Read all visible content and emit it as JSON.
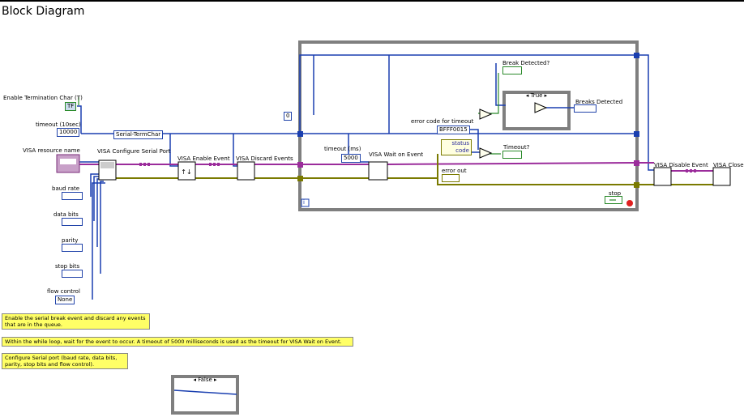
{
  "window": {
    "title": "Block Diagram"
  },
  "inputs": {
    "term_char_enable": {
      "label": "Enable Termination Char (T)",
      "value": "TF"
    },
    "timeout": {
      "label": "timeout (10sec)",
      "value": "10000"
    },
    "resource": {
      "label": "VISA resource name"
    },
    "baud_rate": {
      "label": "baud rate"
    },
    "data_bits": {
      "label": "data bits"
    },
    "parity": {
      "label": "parity"
    },
    "stop_bits": {
      "label": "stop bits"
    },
    "flow_control": {
      "label": "flow control",
      "value": "None"
    }
  },
  "nodes": {
    "configure": {
      "label": "VISA Configure Serial Port"
    },
    "enable_event": {
      "label": "VISA Enable Event"
    },
    "discard_events": {
      "label": "VISA Discard Events"
    },
    "wait_on_event": {
      "label": "VISA Wait on Event"
    },
    "disable_event": {
      "label": "VISA Disable Event"
    },
    "close": {
      "label": "VISA Close"
    }
  },
  "constants": {
    "serial_termchar": "Serial-TermChar",
    "zero": "0",
    "timeout_ms_label": "timeout (ms)",
    "timeout_ms_value": "5000",
    "error_code_label": "error code for timeout",
    "error_code_value": "BFFF0015"
  },
  "loop": {
    "case_true": "True",
    "breaks_detected": "Breaks Detected",
    "break_detected": "Break Detected?",
    "timeout_indicator": "Timeout?",
    "status": "status",
    "code": "code",
    "error_out": "error out",
    "stop": "stop",
    "iteration": "i"
  },
  "case_false": "False",
  "notes": {
    "note1": "Enable the serial break event and discard any events that are in the queue.",
    "note2": "Within the while loop, wait for the event to occur.  A timeout of 5000 milliseconds is used as the timeout for VISA Wait on Event.",
    "note3": "Configure Serial port (baud rate, data bits, parity, stop bits and flow control)."
  },
  "colors": {
    "numeric_wire": "#1a3fb0",
    "error_wire": "#7a7a00",
    "visa_wire": "#9b2c9b",
    "bool_wire": "#2a8a2a",
    "loop_frame": "#7f7f7f",
    "note_bg": "#ffff66"
  }
}
